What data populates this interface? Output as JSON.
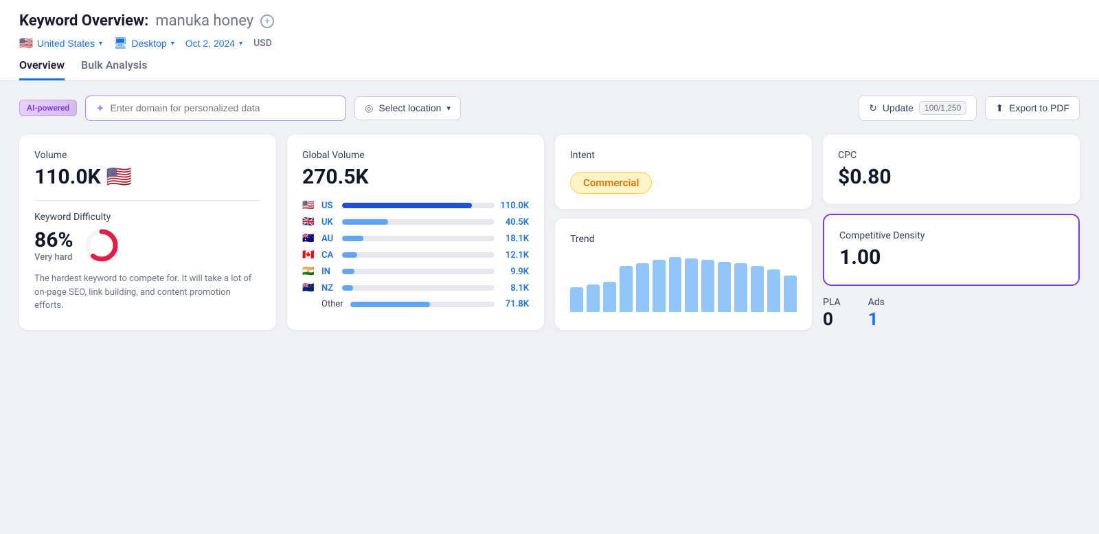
{
  "header": {
    "title": "Keyword Overview:",
    "keyword": "manuka honey",
    "location": "United States",
    "device": "Desktop",
    "date": "Oct 2, 2024",
    "currency": "USD"
  },
  "tabs": [
    {
      "label": "Overview",
      "active": true
    },
    {
      "label": "Bulk Analysis",
      "active": false
    }
  ],
  "toolbar": {
    "ai_badge": "AI-powered",
    "domain_placeholder": "Enter domain for personalized data",
    "location_placeholder": "Select location",
    "update_label": "Update",
    "update_count": "100/1,250",
    "export_label": "Export to PDF"
  },
  "cards": {
    "volume": {
      "label": "Volume",
      "value": "110.0K"
    },
    "keyword_difficulty": {
      "label": "Keyword Difficulty",
      "value": "86%",
      "sublabel": "Very hard",
      "description": "The hardest keyword to compete for. It will take a lot of on-page SEO, link building, and content promotion efforts.",
      "donut_value": 86,
      "donut_color": "#e11d48"
    },
    "global_volume": {
      "label": "Global Volume",
      "value": "270.5K",
      "countries": [
        {
          "flag": "🇺🇸",
          "code": "US",
          "value": "110.0K",
          "width": 85
        },
        {
          "flag": "🇬🇧",
          "code": "UK",
          "value": "40.5K",
          "width": 30
        },
        {
          "flag": "🇦🇺",
          "code": "AU",
          "value": "18.1K",
          "width": 14
        },
        {
          "flag": "🇨🇦",
          "code": "CA",
          "value": "12.1K",
          "width": 10
        },
        {
          "flag": "🇮🇳",
          "code": "IN",
          "value": "9.9K",
          "width": 8
        },
        {
          "flag": "🇳🇿",
          "code": "NZ",
          "value": "8.1K",
          "width": 7
        }
      ],
      "other_label": "Other",
      "other_value": "71.8K",
      "other_width": 55
    },
    "intent": {
      "label": "Intent",
      "badge": "Commercial"
    },
    "trend": {
      "label": "Trend",
      "bars": [
        40,
        45,
        50,
        75,
        80,
        85,
        90,
        88,
        85,
        82,
        80,
        75,
        70,
        60
      ]
    },
    "cpc": {
      "label": "CPC",
      "value": "$0.80"
    },
    "competitive_density": {
      "label": "Competitive Density",
      "value": "1.00"
    },
    "pla": {
      "label": "PLA",
      "value": "0"
    },
    "ads": {
      "label": "Ads",
      "value": "1"
    }
  }
}
